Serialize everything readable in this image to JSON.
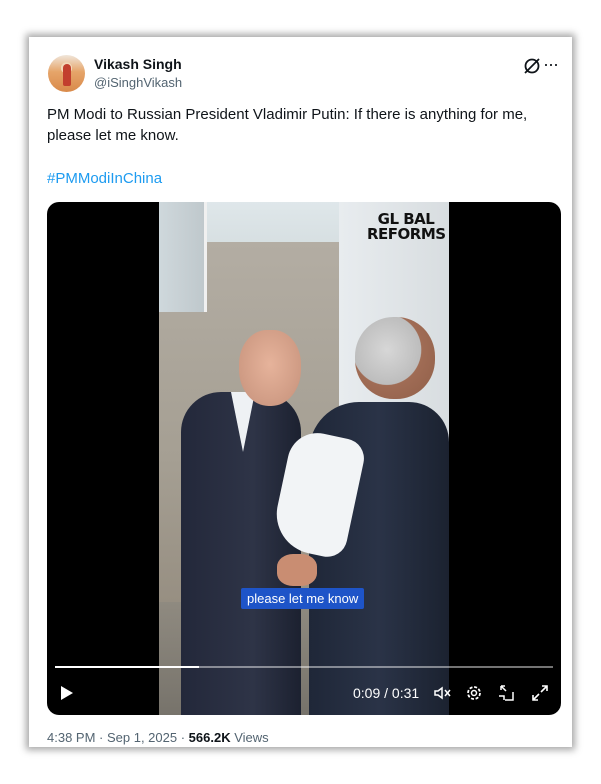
{
  "author": {
    "name": "Vikash Singh",
    "handle": "@iSinghVikash"
  },
  "tweet": {
    "text": "PM Modi to Russian President Vladimir Putin: If there is anything for me, please let me know.",
    "hashtag": "#PMModiInChina"
  },
  "video": {
    "watermark_line1": "GL BAL",
    "watermark_line2": "REFORMS",
    "caption": "please let me know",
    "current_time": "0:09",
    "duration": "0:31",
    "time_display": "0:09 / 0:31",
    "progress": 0.29
  },
  "meta": {
    "timestamp": "4:38 PM · Sep 1, 2025",
    "separator": " · ",
    "views_count": "566.2K",
    "views_label": "Views"
  },
  "colors": {
    "link": "#1d9bf0",
    "caption_bg": "#1e54c8",
    "text_primary": "#0f1419",
    "text_secondary": "#536471"
  },
  "icons": [
    "grok-icon",
    "more-icon",
    "play-icon",
    "mute-icon",
    "settings-icon",
    "pip-icon",
    "fullscreen-icon"
  ]
}
